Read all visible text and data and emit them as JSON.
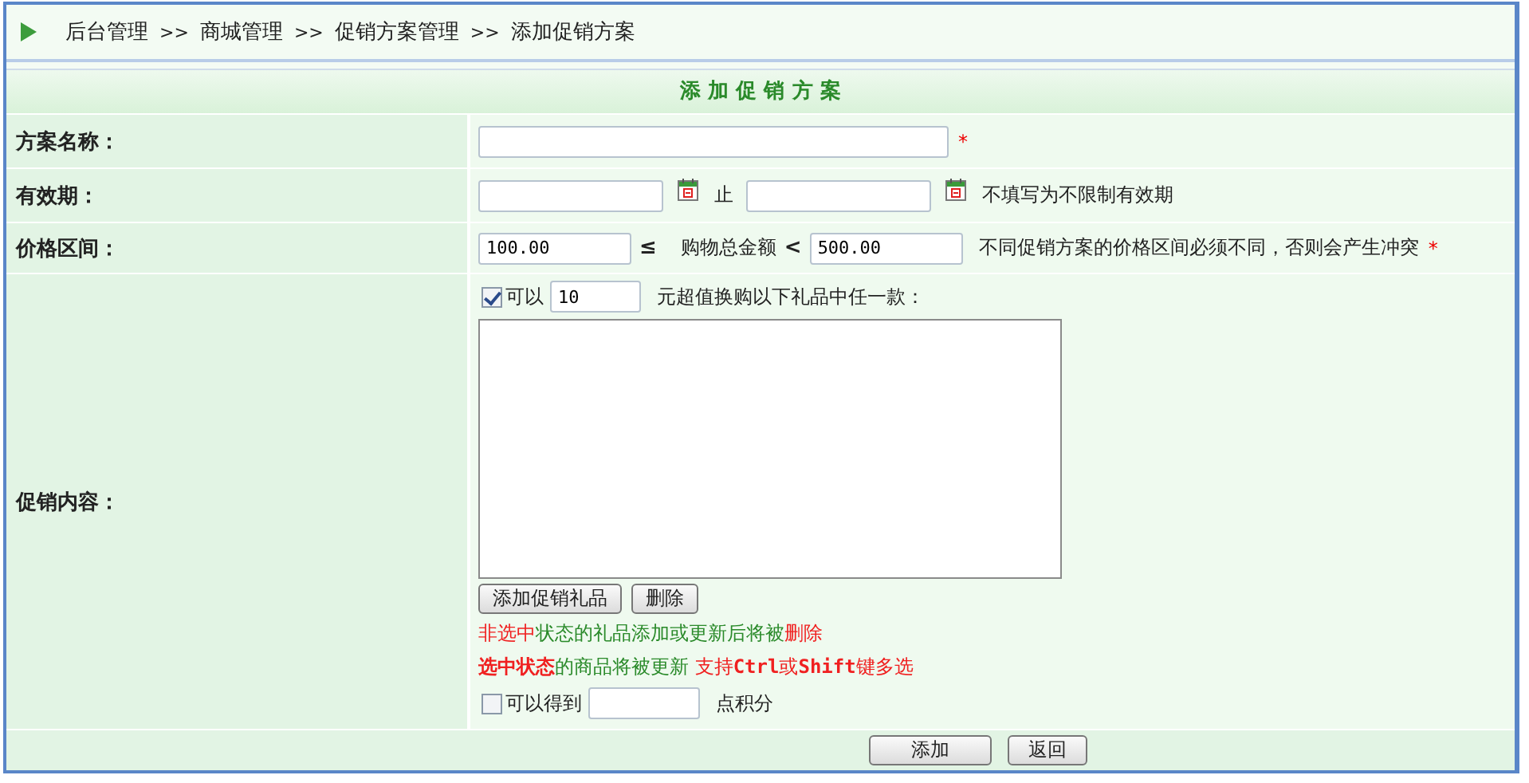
{
  "breadcrumb": {
    "separator": ">>",
    "items": [
      "后台管理",
      "商城管理",
      "促销方案管理",
      "添加促销方案"
    ]
  },
  "form_title": "添 加 促 销 方 案",
  "rows": [
    {
      "kind": "text",
      "label": "方案名称：",
      "required_mark": "*"
    },
    {
      "kind": "date_range",
      "label": "有效期：",
      "between": "止",
      "hint": "不填写为不限制有效期"
    },
    {
      "kind": "price_range",
      "label": "价格区间：",
      "min": "100.00",
      "op1": "≤",
      "middle": "购物总金额",
      "op2": "<",
      "max": "500.00",
      "hint": "不同促销方案的价格区间必须不同，否则会产生冲突",
      "required_mark": "*"
    },
    {
      "kind": "promotion",
      "label": "促销内容：",
      "exchange": {
        "checked": true,
        "before": "可以",
        "amount": "10",
        "after": "元超值换购以下礼品中任一款："
      },
      "buttons": [
        "添加促销礼品",
        "删除"
      ],
      "notes": [
        [
          {
            "text": "非选中",
            "color": "#f02020"
          },
          {
            "text": "状态的礼品添加或更新后将被",
            "color": "#2a8a2a"
          },
          {
            "text": "删除",
            "color": "#f02020"
          }
        ],
        [
          {
            "text": "**选中状态**",
            "color": "#f02020"
          },
          {
            "text": "的商品将被更新",
            "color": "#2a8a2a"
          },
          {
            "text": " 支持**Ctrl**或**Shift**键多选",
            "color": "#f02020"
          }
        ]
      ],
      "points": {
        "checked": false,
        "before": "可以得到",
        "after": "点积分"
      }
    }
  ],
  "actions": [
    "添加",
    "返回"
  ]
}
